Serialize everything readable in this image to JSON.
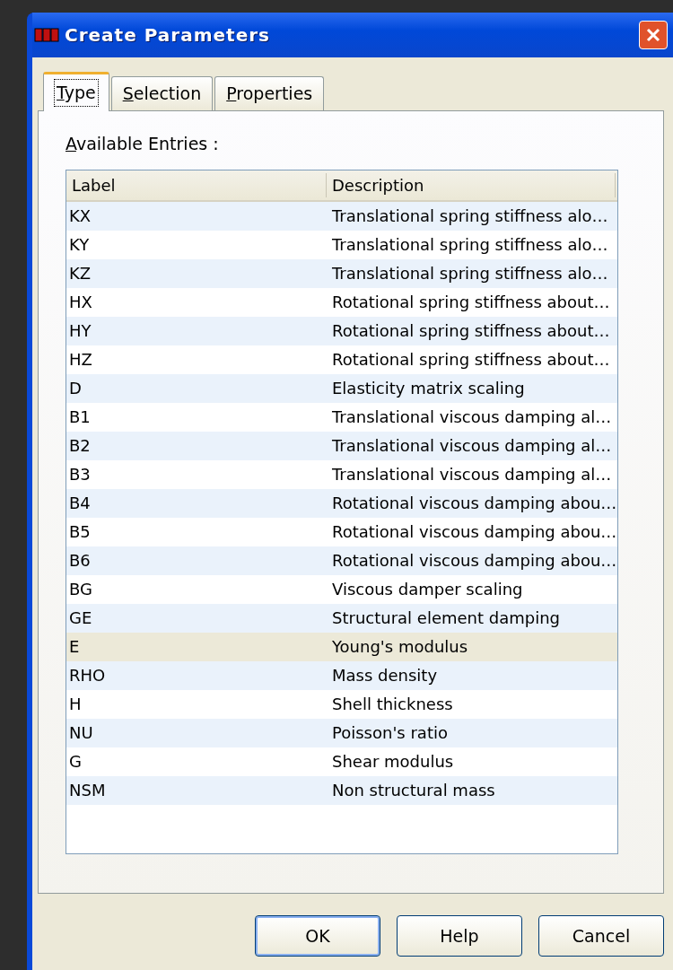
{
  "window": {
    "title": "Create Parameters"
  },
  "tabs": [
    {
      "label": "Type",
      "selected": true
    },
    {
      "label": "Selection",
      "selected": false
    },
    {
      "label": "Properties",
      "selected": false
    }
  ],
  "list_label": "Available Entries :",
  "table": {
    "columns": [
      "Label",
      "Description"
    ],
    "rows": [
      {
        "label": "KX",
        "description": "Translational spring stiffness alo…",
        "selected": false
      },
      {
        "label": "KY",
        "description": "Translational spring stiffness alo…",
        "selected": false
      },
      {
        "label": "KZ",
        "description": "Translational spring stiffness alo…",
        "selected": false
      },
      {
        "label": "HX",
        "description": "Rotational spring stiffness about…",
        "selected": false
      },
      {
        "label": "HY",
        "description": "Rotational spring stiffness about…",
        "selected": false
      },
      {
        "label": "HZ",
        "description": "Rotational spring stiffness about…",
        "selected": false
      },
      {
        "label": "D",
        "description": "Elasticity matrix scaling",
        "selected": false
      },
      {
        "label": "B1",
        "description": "Translational viscous damping al…",
        "selected": false
      },
      {
        "label": "B2",
        "description": "Translational viscous damping al…",
        "selected": false
      },
      {
        "label": "B3",
        "description": "Translational viscous damping al…",
        "selected": false
      },
      {
        "label": "B4",
        "description": "Rotational viscous damping abou…",
        "selected": false
      },
      {
        "label": "B5",
        "description": "Rotational viscous damping abou…",
        "selected": false
      },
      {
        "label": "B6",
        "description": "Rotational viscous damping abou…",
        "selected": false
      },
      {
        "label": "BG",
        "description": "Viscous damper scaling",
        "selected": false
      },
      {
        "label": "GE",
        "description": "Structural element damping",
        "selected": false
      },
      {
        "label": "E",
        "description": "Young's modulus",
        "selected": true
      },
      {
        "label": "RHO",
        "description": "Mass density",
        "selected": false
      },
      {
        "label": "H",
        "description": "Shell thickness",
        "selected": false
      },
      {
        "label": "NU",
        "description": "Poisson's ratio",
        "selected": false
      },
      {
        "label": "G",
        "description": "Shear modulus",
        "selected": false
      },
      {
        "label": "NSM",
        "description": "Non structural mass",
        "selected": false
      }
    ]
  },
  "buttons": [
    {
      "label": "OK",
      "default": true
    },
    {
      "label": "Help",
      "default": false
    },
    {
      "label": "Cancel",
      "default": false
    }
  ]
}
